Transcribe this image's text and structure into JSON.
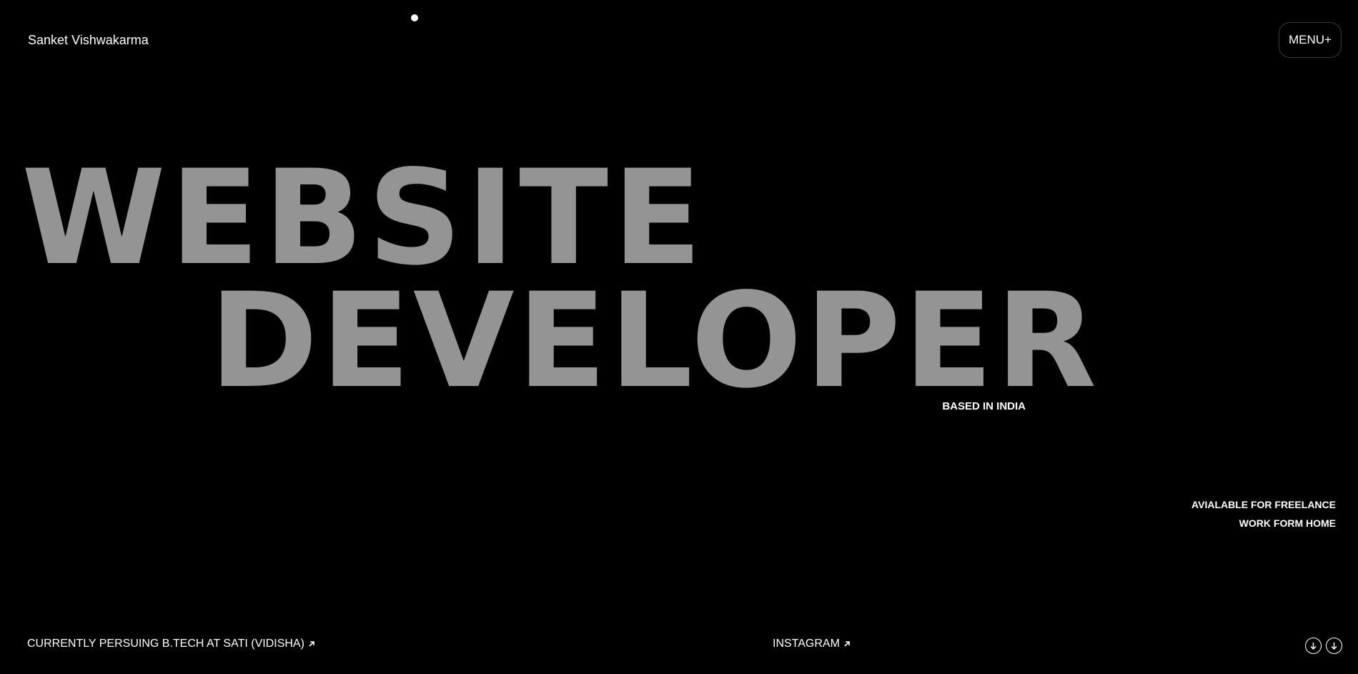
{
  "header": {
    "brand_name": "Sanket Vishwakarma",
    "menu_label": "MENU+"
  },
  "hero": {
    "line1": "WEBSITE",
    "line2": "DEVELOPER",
    "location": "BASED IN INDIA"
  },
  "availability": {
    "line1": "AVIALABLE FOR FREELANCE",
    "line2": "WORK FORM HOME"
  },
  "footer": {
    "study_link": "CURRENTLY PERSUING B.TECH AT SATI (VIDISHA)",
    "instagram_link": "INSTAGRAM",
    "link_icon": "arrow-up-right-icon",
    "scroll_icon": "arrow-down-circle-icon"
  },
  "colors": {
    "background": "#000000",
    "headline": "#949494",
    "text": "#ffffff"
  }
}
